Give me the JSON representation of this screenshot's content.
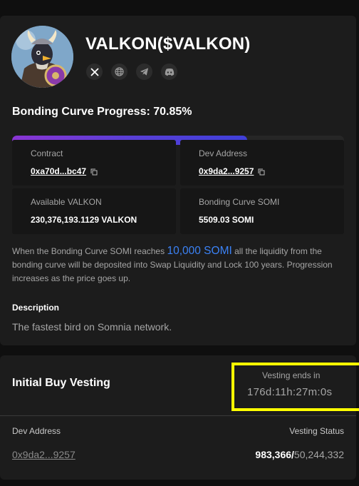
{
  "token": {
    "title": "VALKON($VALKON)",
    "avatar_icon": "viking-bird-icon",
    "socials": [
      "x-icon",
      "globe-icon",
      "telegram-icon",
      "discord-icon"
    ]
  },
  "bonding": {
    "title": "Bonding Curve Progress: 70.85%",
    "progress_percent": 70.85
  },
  "info": {
    "contract_label": "Contract",
    "contract_value": "0xa70d...bc47",
    "dev_label": "Dev Address",
    "dev_value": "0x9da2...9257",
    "available_label": "Available VALKON",
    "available_value": "230,376,193.1129 VALKON",
    "curve_somi_label": "Bonding Curve SOMI",
    "curve_somi_value": "5509.03 SOMI"
  },
  "note": {
    "prefix": "When the Bonding Curve SOMI reaches ",
    "target": "10,000 SOMI",
    "suffix": " all the liquidity from the bonding curve will be deposited into Swap Liquidity and Lock 100 years. Progression increases as the price goes up."
  },
  "description": {
    "label": "Description",
    "text": "The fastest bird on Somnia network."
  },
  "vesting": {
    "title": "Initial Buy Vesting",
    "ends_label": "Vesting ends in",
    "timer": "176d:11h:27m:0s",
    "dev_col_label": "Dev Address",
    "status_col_label": "Vesting Status",
    "dev_value": "0x9da2...9257",
    "status_done": "983,366/",
    "status_total": "50,244,332"
  },
  "colors": {
    "accent_blue": "#3b82f6",
    "progress_start": "#8a35d4",
    "progress_end": "#3f3fd9",
    "highlight": "#ffff00"
  }
}
